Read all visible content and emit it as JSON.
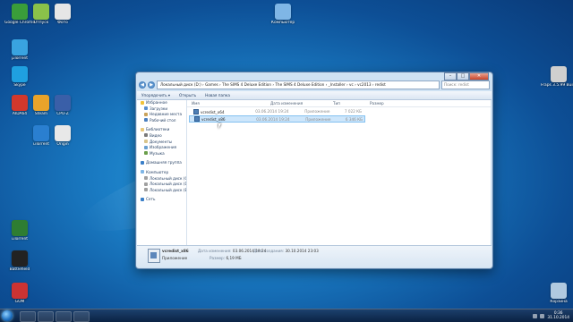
{
  "desktop": {
    "icons": [
      {
        "label": "Google Chrome",
        "color": "#3a9d3a"
      },
      {
        "label": "Отпуск",
        "color": "#8ac24a"
      },
      {
        "label": "Фото",
        "color": "#e6e6e6"
      },
      {
        "label": "µTorrent",
        "color": "#39a3e0"
      },
      {
        "label": "Skype",
        "color": "#1fa0e0"
      },
      {
        "label": "AIDA64",
        "color": "#d2382c"
      },
      {
        "label": "Steam",
        "color": "#e9a32a"
      },
      {
        "label": "CPU-Z",
        "color": "#3a5fa8"
      },
      {
        "label": "uTorrent",
        "color": "#2a7fd0"
      },
      {
        "label": "Origin",
        "color": "#e8e8e8"
      },
      {
        "label": "uTorrent",
        "color": "#2e7d32"
      },
      {
        "label": "Battlefield",
        "color": "#222222"
      },
      {
        "label": "GOM",
        "color": "#cc3333"
      },
      {
        "label": "Компьютер",
        "color": "#7fb6e6"
      },
      {
        "label": "Fraps 3.5.99 Build 15618",
        "color": "#cfcfcf"
      },
      {
        "label": "Корзина",
        "color": "#b0c9e0"
      }
    ]
  },
  "window": {
    "address": "Локальный диск (D:) › Games › The SIMS 4 Deluxe Edition › The SIMS 4 Deluxe Edition › _Installer › vc › vc2013 › redist",
    "search_placeholder": "Поиск: redist",
    "toolbar": {
      "organize": "Упорядочить ▾",
      "open": "Открыть",
      "new_folder": "Новая папка"
    },
    "nav": [
      {
        "label": "Избранное",
        "group": true,
        "color": "#f2c23a"
      },
      {
        "label": "Загрузки",
        "group": false,
        "color": "#5a8fd0"
      },
      {
        "label": "Недавние места",
        "group": false,
        "color": "#c9a25a"
      },
      {
        "label": "Рабочий стол",
        "group": false,
        "color": "#4a7fc0"
      },
      {
        "label": "Библиотеки",
        "group": true,
        "color": "#e8c87a"
      },
      {
        "label": "Видео",
        "group": false,
        "color": "#7a7a7a"
      },
      {
        "label": "Документы",
        "group": false,
        "color": "#d8c48a"
      },
      {
        "label": "Изображения",
        "group": false,
        "color": "#6aa0d0"
      },
      {
        "label": "Музыка",
        "group": false,
        "color": "#6a9e4a"
      },
      {
        "label": "Домашняя группа",
        "group": true,
        "color": "#3a7fc8"
      },
      {
        "label": "Компьютер",
        "group": true,
        "color": "#7fb6e6"
      },
      {
        "label": "Локальный диск (C:)",
        "group": false,
        "color": "#a0a0a0"
      },
      {
        "label": "Локальный диск (D:)",
        "group": false,
        "color": "#a0a0a0"
      },
      {
        "label": "Локальный диск (E:)",
        "group": false,
        "color": "#a0a0a0"
      },
      {
        "label": "Сеть",
        "group": true,
        "color": "#3a7fc8"
      }
    ],
    "columns": {
      "name": "Имя",
      "date": "Дата изменения",
      "type": "Тип",
      "size": "Размер"
    },
    "files": [
      {
        "name": "vcredist_x64",
        "date": "03.06.2014 19:24",
        "type": "Приложение",
        "size": "7 022 КБ",
        "selected": false
      },
      {
        "name": "vcredist_x86",
        "date": "03.06.2014 19:24",
        "type": "Приложение",
        "size": "6 346 КБ",
        "selected": true
      }
    ],
    "details": {
      "name": "vcredist_x86",
      "modified_label": "Дата изменения:",
      "modified": "03.06.2014 19:24",
      "created_label": "Дата создания:",
      "created": "30.10.2014 23:03",
      "kind": "Приложение",
      "size_label": "Размер:",
      "size": "6,19 МБ"
    }
  },
  "taskbar": {
    "time": "0:36",
    "date": "31.10.2014"
  }
}
